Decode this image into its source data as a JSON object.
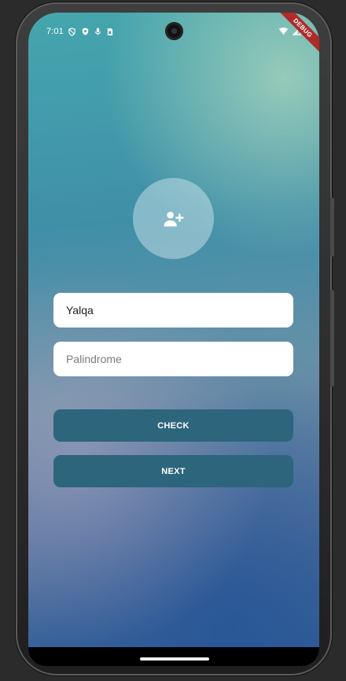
{
  "status_bar": {
    "time": "7:01",
    "left_icons": [
      "privacy-shield-icon",
      "shield-icon",
      "mic-icon",
      "sim-card-icon"
    ],
    "right_icons": [
      "wifi-icon",
      "signal-icon",
      "battery-icon"
    ]
  },
  "debug_banner": {
    "label": "DEBUG",
    "color": "#af2a2a"
  },
  "profile": {
    "avatar_icon": "add-user-icon"
  },
  "form": {
    "name": {
      "value": "Yalqa",
      "placeholder": ""
    },
    "palindrome": {
      "value": "",
      "placeholder": "Palindrome"
    }
  },
  "actions": {
    "check_label": "CHECK",
    "next_label": "NEXT",
    "button_color": "#2d657c"
  }
}
